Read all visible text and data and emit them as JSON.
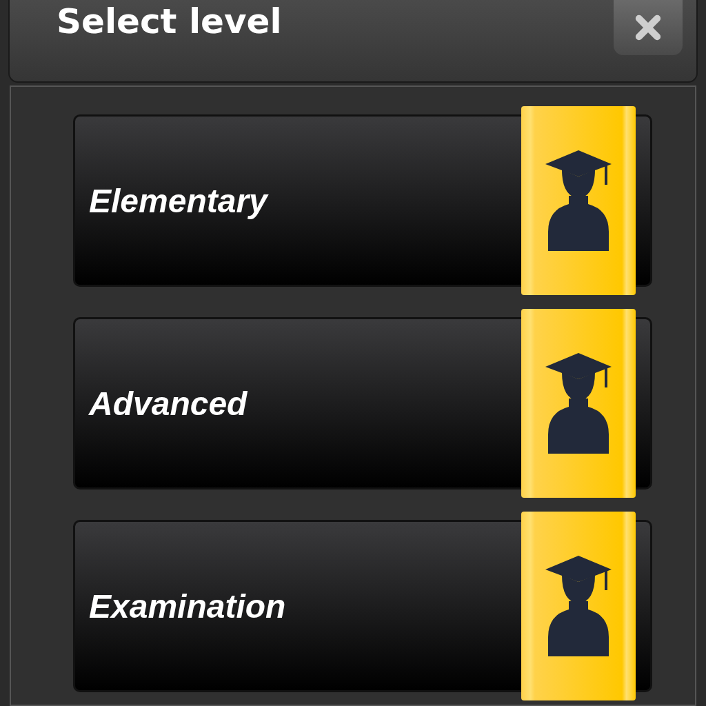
{
  "window": {
    "title": "Select level"
  },
  "levels": [
    {
      "label": "Elementary"
    },
    {
      "label": "Advanced"
    },
    {
      "label": "Examination"
    }
  ]
}
